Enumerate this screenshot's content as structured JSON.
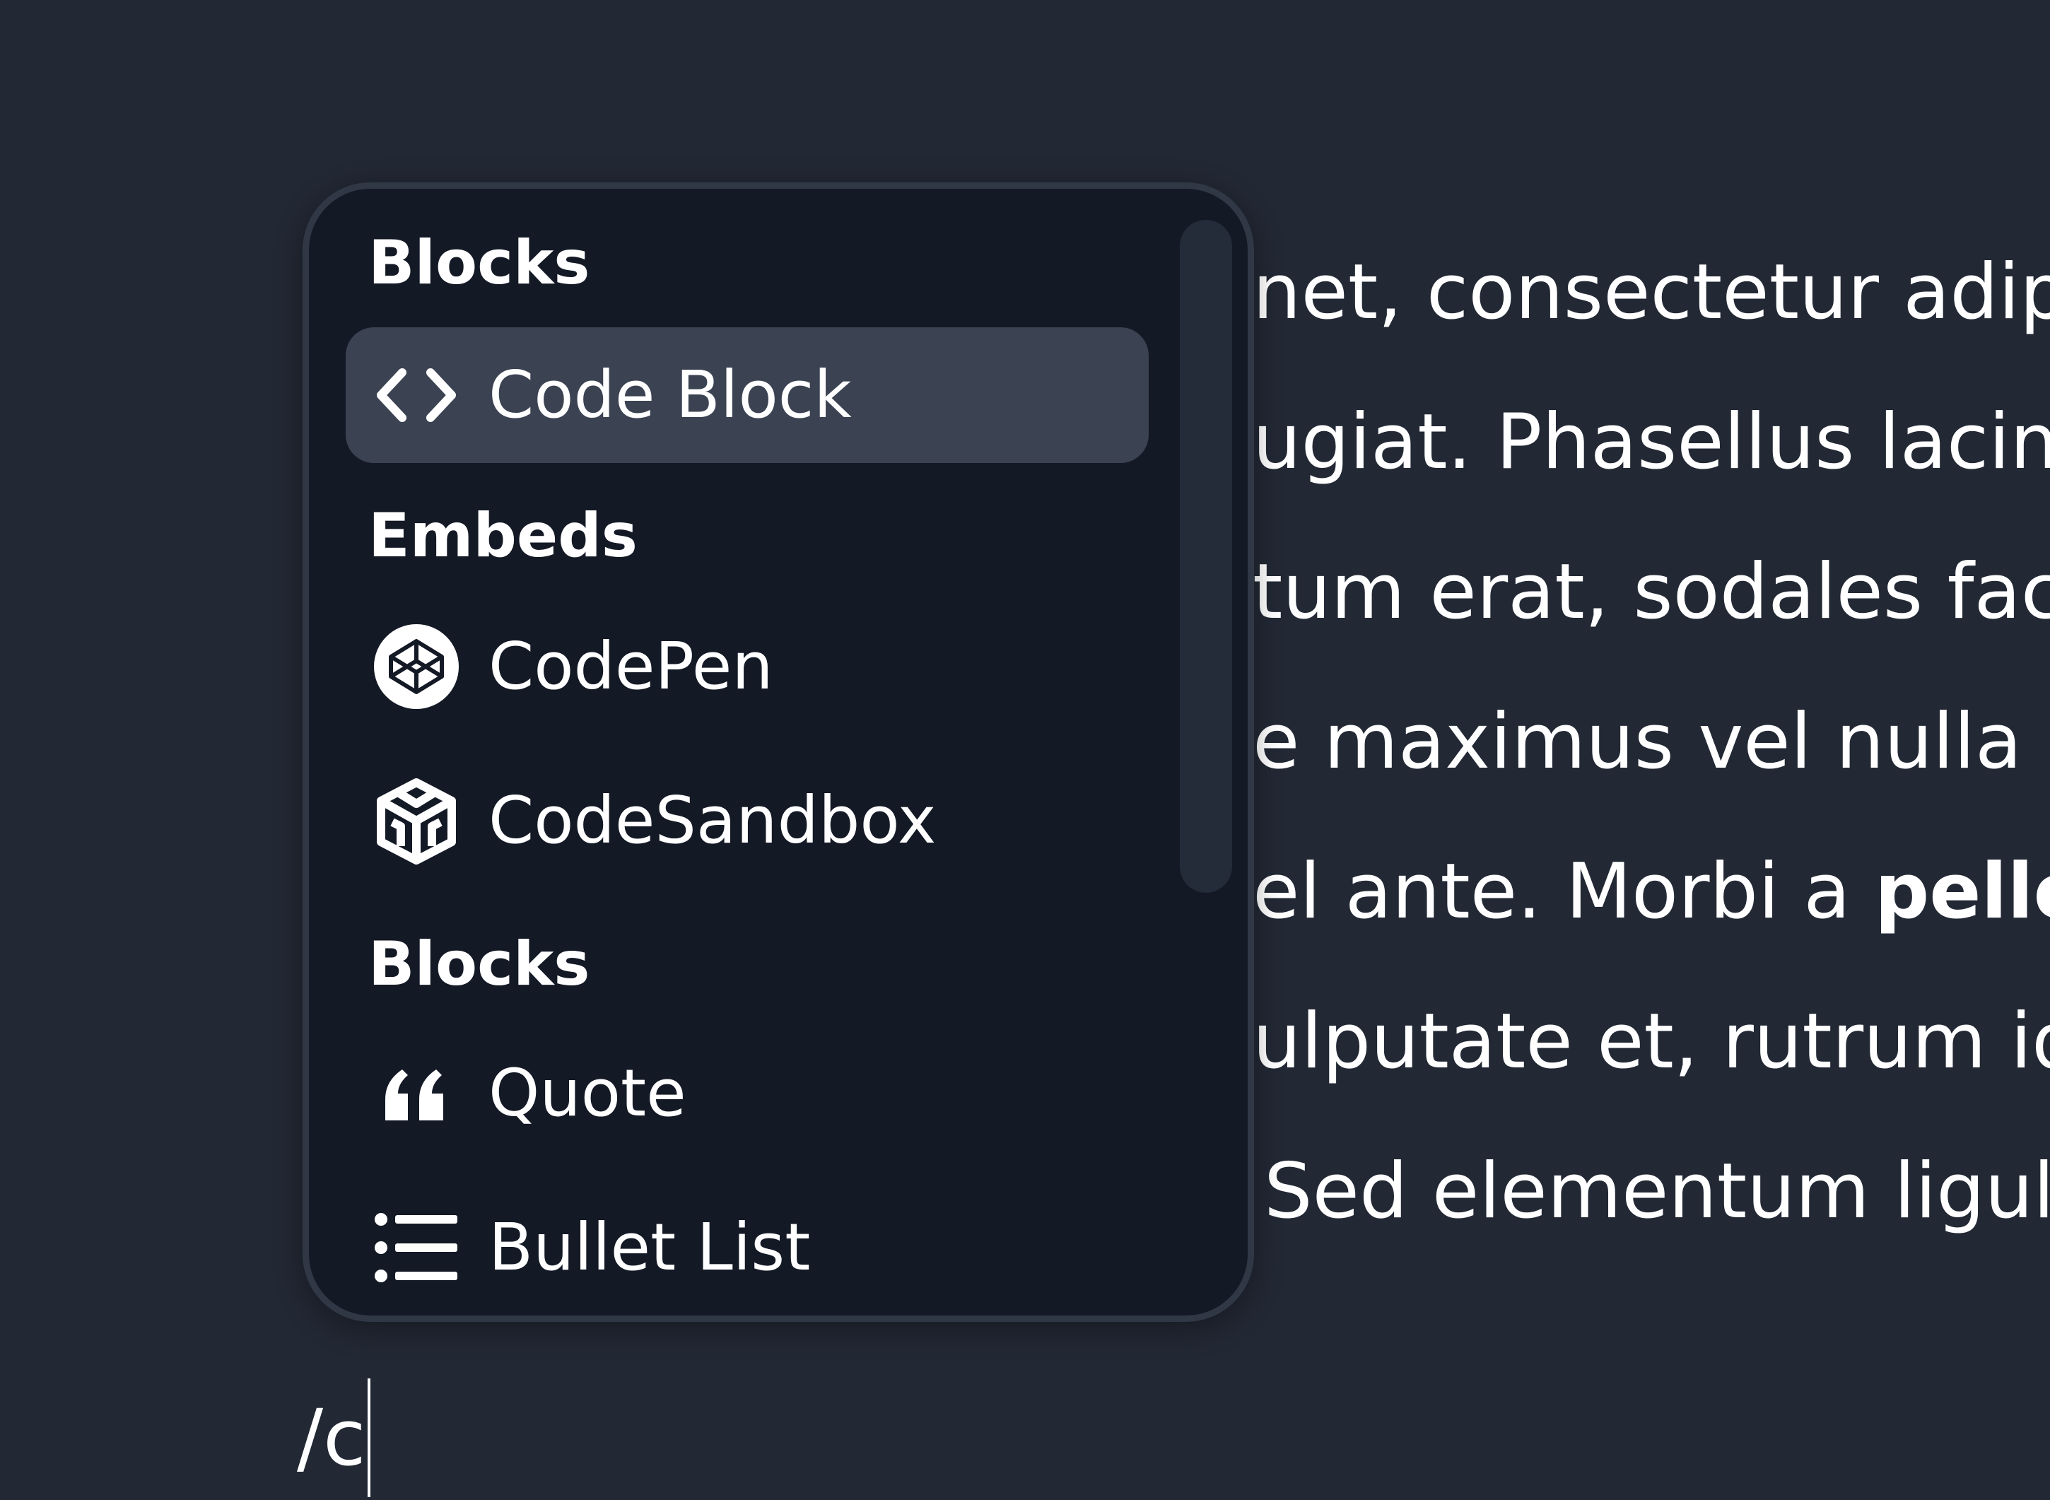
{
  "editor": {
    "lines": [
      "net, consectetur adipis",
      "ugiat. Phasellus lacin",
      "tum erat, sodales fac",
      "e maximus vel nulla q",
      "el ante. Morbi a ",
      "ulputate et, rutrum id",
      "Sed elementum ligul"
    ],
    "bold_fragment": "peller",
    "slash_input_value": "/c"
  },
  "menu": {
    "sections": [
      {
        "label": "Blocks",
        "items": [
          {
            "label": "Code Block",
            "icon": "code-icon",
            "active": true
          }
        ]
      },
      {
        "label": "Embeds",
        "items": [
          {
            "label": "CodePen",
            "icon": "codepen-icon",
            "active": false
          },
          {
            "label": "CodeSandbox",
            "icon": "codesandbox-icon",
            "active": false
          }
        ]
      },
      {
        "label": "Blocks",
        "items": [
          {
            "label": "Quote",
            "icon": "quote-icon",
            "active": false
          },
          {
            "label": "Bullet List",
            "icon": "bullet-list-icon",
            "active": false
          }
        ]
      }
    ]
  },
  "colors": {
    "background": "#222834",
    "menu_background": "#141926",
    "menu_border": "#303846",
    "active_item": "#3b4252",
    "text": "#ffffff"
  }
}
